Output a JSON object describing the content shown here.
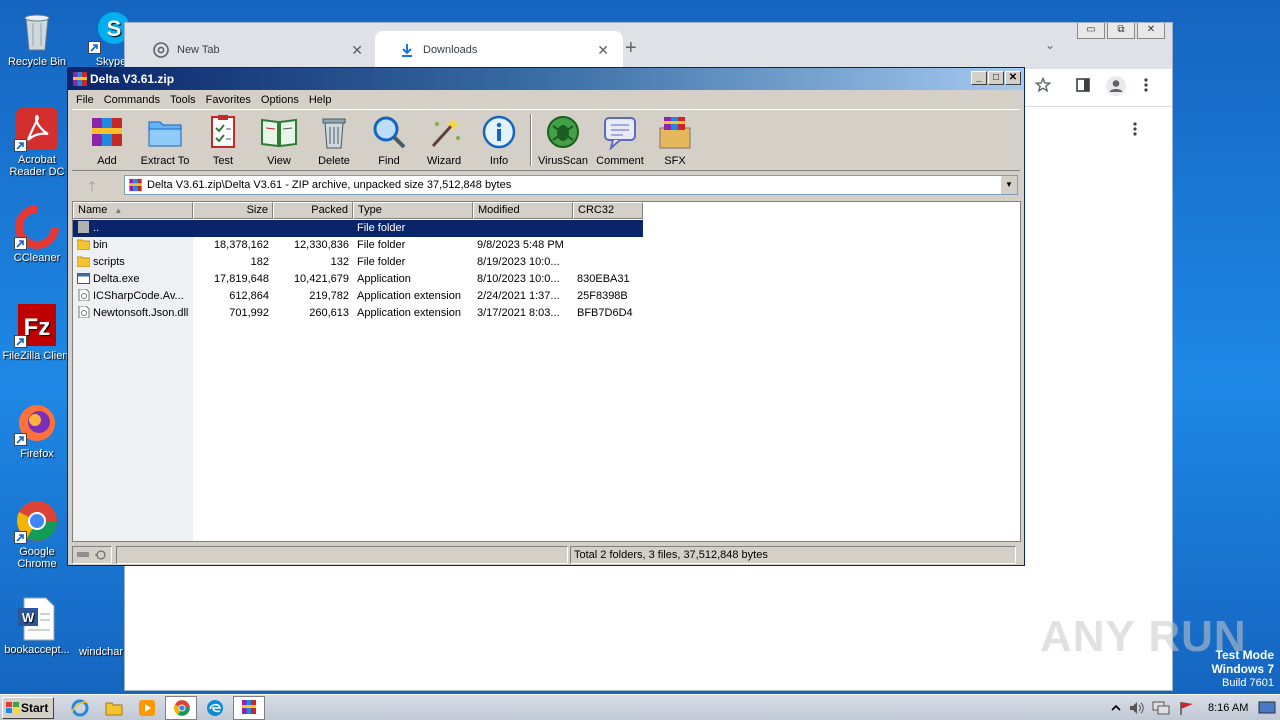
{
  "desktop": {
    "icons": [
      {
        "label": "Recycle Bin",
        "icon": "recycle-bin-icon"
      },
      {
        "label": "Skype",
        "icon": "skype-icon"
      },
      {
        "label": "Acrobat Reader DC",
        "icon": "acrobat-icon"
      },
      {
        "label": "CCleaner",
        "icon": "ccleaner-icon"
      },
      {
        "label": "FileZilla Client",
        "icon": "filezilla-icon"
      },
      {
        "label": "Firefox",
        "icon": "firefox-icon"
      },
      {
        "label": "Google Chrome",
        "icon": "chrome-icon"
      },
      {
        "label": "bookaccept...",
        "icon": "word-doc-icon"
      },
      {
        "label": "windchar",
        "icon": "file-icon"
      }
    ]
  },
  "chrome": {
    "tabs": [
      {
        "label": "New Tab",
        "icon": "chrome-icon"
      },
      {
        "label": "Downloads",
        "icon": "download-icon"
      }
    ],
    "new_tab_symbol": "+",
    "tab_list_symbol": "⌄",
    "window_controls": [
      "▭",
      "⧉",
      "✕"
    ],
    "toolbar_icons": [
      "star-icon",
      "side-panel-icon",
      "profile-icon",
      "menu-icon"
    ]
  },
  "winrar": {
    "title": "Delta V3.61.zip",
    "menu": [
      "File",
      "Commands",
      "Tools",
      "Favorites",
      "Options",
      "Help"
    ],
    "toolbar": [
      {
        "label": "Add",
        "icon": "add-icon",
        "color": "#b03a2e"
      },
      {
        "label": "Extract To",
        "icon": "extract-folder-icon",
        "color": "#3a86d6"
      },
      {
        "label": "Test",
        "icon": "test-clipboard-icon",
        "color": "#c0392b"
      },
      {
        "label": "View",
        "icon": "view-book-icon",
        "color": "#2e7d32"
      },
      {
        "label": "Delete",
        "icon": "delete-trash-icon",
        "color": "#90a4ae"
      },
      {
        "label": "Find",
        "icon": "find-magnifier-icon",
        "color": "#1e88e5"
      },
      {
        "label": "Wizard",
        "icon": "wizard-wand-icon",
        "color": "#7cb342"
      },
      {
        "label": "Info",
        "icon": "info-icon",
        "color": "#1565c0"
      },
      {
        "label": "VirusScan",
        "icon": "virus-scan-icon",
        "color": "#2e7d32"
      },
      {
        "label": "Comment",
        "icon": "comment-icon",
        "color": "#5c6bc0"
      },
      {
        "label": "SFX",
        "icon": "sfx-box-icon",
        "color": "#d4a017"
      }
    ],
    "address": "Delta V3.61.zip\\Delta V3.61 - ZIP archive, unpacked size 37,512,848 bytes",
    "columns": [
      "Name",
      "Size",
      "Packed",
      "Type",
      "Modified",
      "CRC32"
    ],
    "rows": [
      {
        "name": "..",
        "size": "",
        "packed": "",
        "type": "File folder",
        "modified": "",
        "crc": "",
        "icon": "parent-folder-icon"
      },
      {
        "name": "bin",
        "size": "18,378,162",
        "packed": "12,330,836",
        "type": "File folder",
        "modified": "9/8/2023 5:48 PM",
        "crc": "",
        "icon": "folder-icon"
      },
      {
        "name": "scripts",
        "size": "182",
        "packed": "132",
        "type": "File folder",
        "modified": "8/19/2023 10:0...",
        "crc": "",
        "icon": "folder-icon"
      },
      {
        "name": "Delta.exe",
        "size": "17,819,648",
        "packed": "10,421,679",
        "type": "Application",
        "modified": "8/10/2023 10:0...",
        "crc": "830EBA31",
        "icon": "exe-icon"
      },
      {
        "name": "ICSharpCode.Av...",
        "size": "612,864",
        "packed": "219,782",
        "type": "Application extension",
        "modified": "2/24/2021 1:37...",
        "crc": "25F8398B",
        "icon": "dll-icon"
      },
      {
        "name": "Newtonsoft.Json.dll",
        "size": "701,992",
        "packed": "260,613",
        "type": "Application extension",
        "modified": "3/17/2021 8:03...",
        "crc": "BFB7D6D4",
        "icon": "dll-icon"
      }
    ],
    "status": "Total 2 folders, 3 files, 37,512,848 bytes"
  },
  "watermark": "ANY RUN",
  "testmode": {
    "line1": "Test Mode",
    "line2": "Windows 7",
    "line3": "Build 7601"
  },
  "taskbar": {
    "start_label": "Start",
    "apps": [
      "ie-icon",
      "explorer-icon",
      "media-player-icon",
      "chrome-icon",
      "edge-icon",
      "winrar-icon"
    ],
    "clock": "8:16 AM"
  },
  "colors": {
    "desktop": "#1e88e5",
    "title_active": "#0a246a",
    "selection": "#0a246a"
  }
}
